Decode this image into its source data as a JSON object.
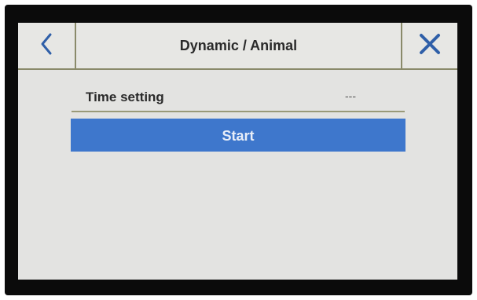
{
  "header": {
    "title": "Dynamic / Animal",
    "back_icon": "chevron-left-icon",
    "close_icon": "close-icon"
  },
  "settings": [
    {
      "label": "Time setting",
      "value": "---"
    }
  ],
  "actions": {
    "start_label": "Start"
  },
  "colors": {
    "accent": "#3e77cc",
    "icon": "#2f5fa8",
    "divider": "#8a8a6a",
    "background": "#e3e3e1"
  }
}
